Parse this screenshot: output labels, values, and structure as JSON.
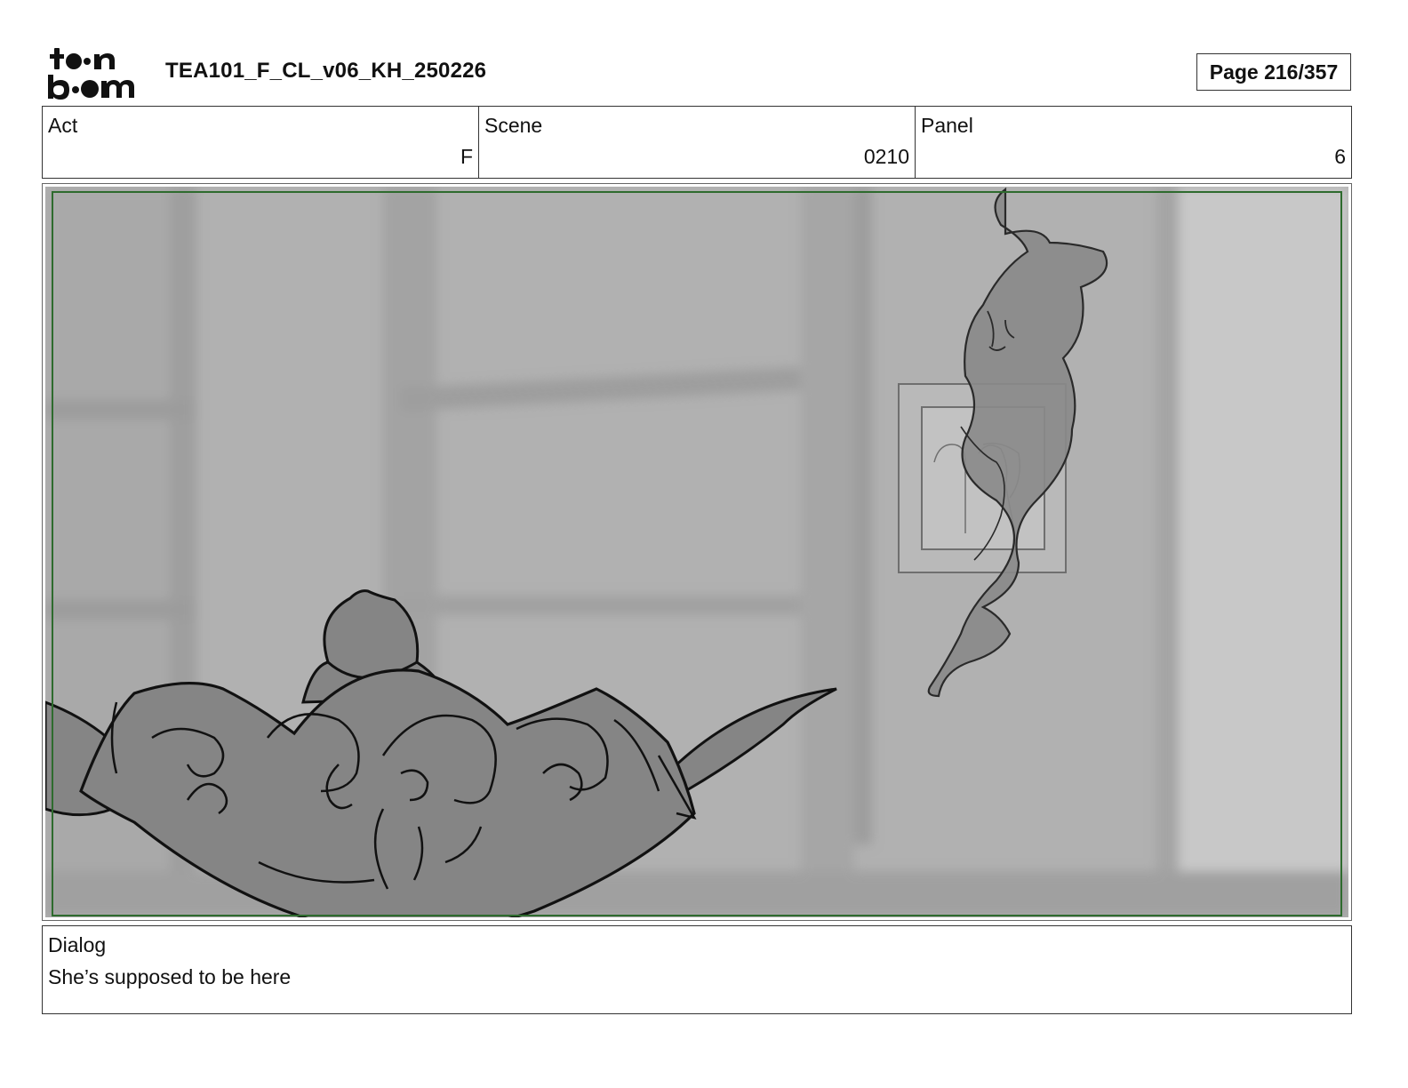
{
  "header": {
    "logo_text": "toon boom",
    "document_title": "TEA101_F_CL_v06_KH_250226",
    "page_indicator": "Page 216/357"
  },
  "info": {
    "act": {
      "label": "Act",
      "value": "F"
    },
    "scene": {
      "label": "Scene",
      "value": "0210"
    },
    "panel": {
      "label": "Panel",
      "value": "6"
    }
  },
  "drawing": {
    "safe_frame_color": "#2e6b2e",
    "background_color": "#b0b0b0",
    "teapot_fill": "#858585",
    "smoke_fill": "#8a8a8a"
  },
  "dialog": {
    "label": "Dialog",
    "text": "She’s supposed to be here"
  }
}
